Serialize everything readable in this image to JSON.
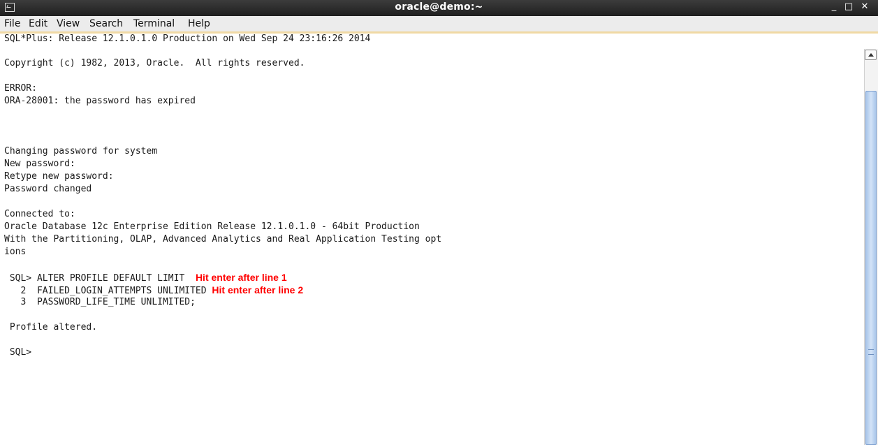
{
  "window": {
    "title": "oracle@demo:~",
    "controls": {
      "minimize": "_",
      "maximize": "□",
      "close": "✕"
    }
  },
  "menu": {
    "items": [
      "File",
      "Edit",
      "View",
      "Search",
      "Terminal",
      "Help"
    ]
  },
  "terminal": {
    "lines": [
      "SQL*Plus: Release 12.1.0.1.0 Production on Wed Sep 24 23:16:26 2014",
      "Copyright (c) 1982, 2013, Oracle.  All rights reserved.",
      "ERROR:",
      "ORA-28001: the password has expired",
      "Changing password for system",
      "New password:",
      "Retype new password:",
      "Password changed",
      "Connected to:",
      "Oracle Database 12c Enterprise Edition Release 12.1.0.1.0 - 64bit Production",
      "With the Partitioning, OLAP, Advanced Analytics and Real Application Testing opt",
      "ions",
      " SQL> ALTER PROFILE DEFAULT LIMIT",
      "   2  FAILED_LOGIN_ATTEMPTS UNLIMITED",
      "   3  PASSWORD_LIFE_TIME UNLIMITED;",
      " Profile altered.",
      " SQL>"
    ],
    "annotations": [
      "Hit enter after line 1",
      "Hit enter after line 2"
    ]
  },
  "colors": {
    "annotation": "#ff0000",
    "titlebar": "#2b2b2b",
    "scroll_thumb": "#bcd3f0"
  }
}
